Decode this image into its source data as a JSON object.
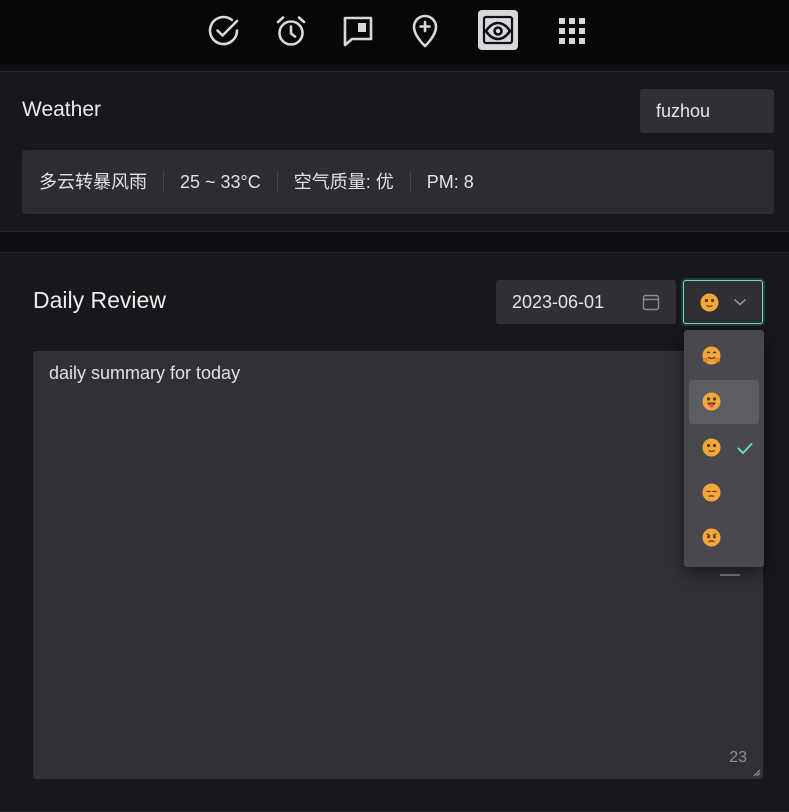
{
  "toolbar": {
    "items": [
      {
        "icon": "check-circle-icon",
        "active": false
      },
      {
        "icon": "alarm-clock-icon",
        "active": false
      },
      {
        "icon": "comment-square-icon",
        "active": false
      },
      {
        "icon": "location-pin-plus-icon",
        "active": false
      },
      {
        "icon": "eye-icon",
        "active": true
      },
      {
        "icon": "grid-apps-icon",
        "active": false
      }
    ]
  },
  "weather": {
    "title": "Weather",
    "city_value": "fuzhou",
    "condition": "多云转暴风雨",
    "temperature": "25 ~ 33°C",
    "air_quality": "空气质量: 优",
    "pm": "PM: 8"
  },
  "review": {
    "title": "Daily Review",
    "date": "2023-06-01",
    "selected_mood": "neutral-smile",
    "text": "daily summary for today",
    "char_count": "23"
  },
  "mood_options": [
    {
      "name": "hug-face",
      "selected": false,
      "hovered": false
    },
    {
      "name": "tongue-face",
      "selected": false,
      "hovered": true
    },
    {
      "name": "neutral-smile",
      "selected": true,
      "hovered": false
    },
    {
      "name": "pensive-face",
      "selected": false,
      "hovered": false
    },
    {
      "name": "angry-face",
      "selected": false,
      "hovered": false
    }
  ],
  "colors": {
    "accent": "#63e2b7",
    "emoji_face": "#f5a623",
    "background": "#101014",
    "card": "#18181c"
  }
}
